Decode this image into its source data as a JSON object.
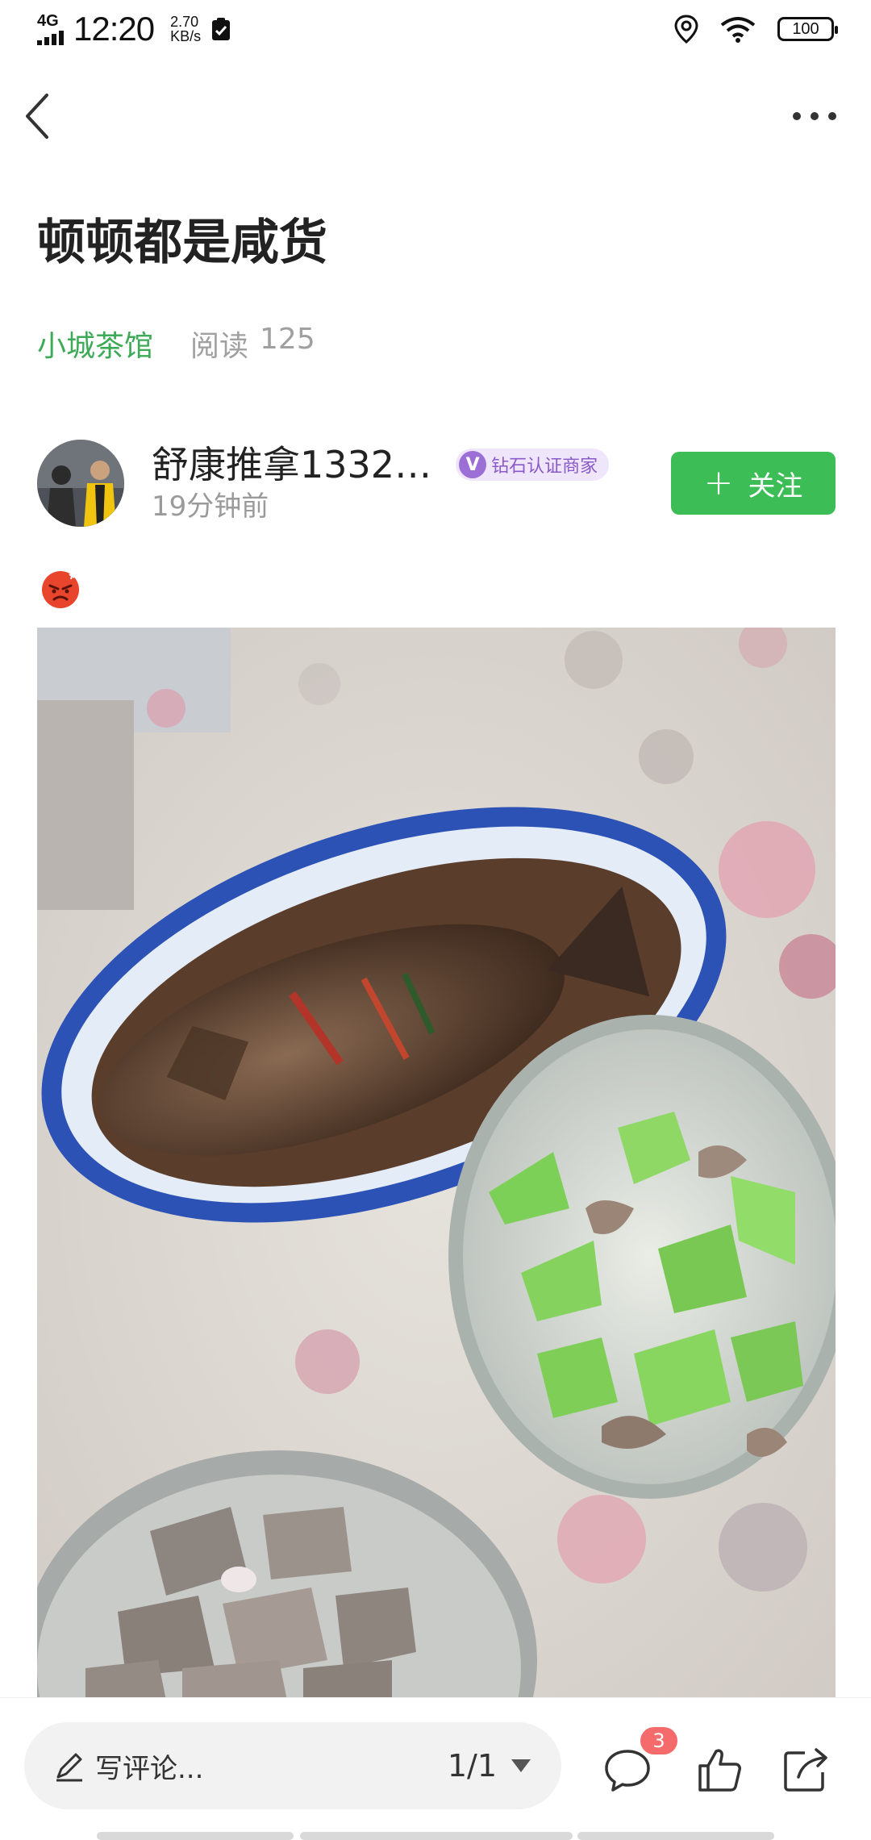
{
  "status_bar": {
    "network": "4G",
    "time": "12:20",
    "speed_value": "2.70",
    "speed_unit": "KB/s",
    "battery": "100"
  },
  "nav": {
    "back_icon": "back-chevron-icon",
    "more_icon": "more-dots-icon"
  },
  "article": {
    "title": "顿顿都是咸货",
    "channel": "小城茶馆",
    "reads_label": "阅读",
    "reads_count": "125"
  },
  "author": {
    "name": "舒康推拿1332…",
    "badge_letter": "V",
    "badge_text": "钻石认证商家",
    "time_ago": "19分钟前",
    "follow_label": "关注"
  },
  "bottom_bar": {
    "comment_placeholder": "写评论...",
    "page_indicator": "1/1",
    "comment_count": "3"
  },
  "colors": {
    "brand_green": "#3dbd56",
    "channel_green": "#3daa57",
    "badge_purple": "#9b6fd6",
    "notify_red": "#f56b6b"
  }
}
